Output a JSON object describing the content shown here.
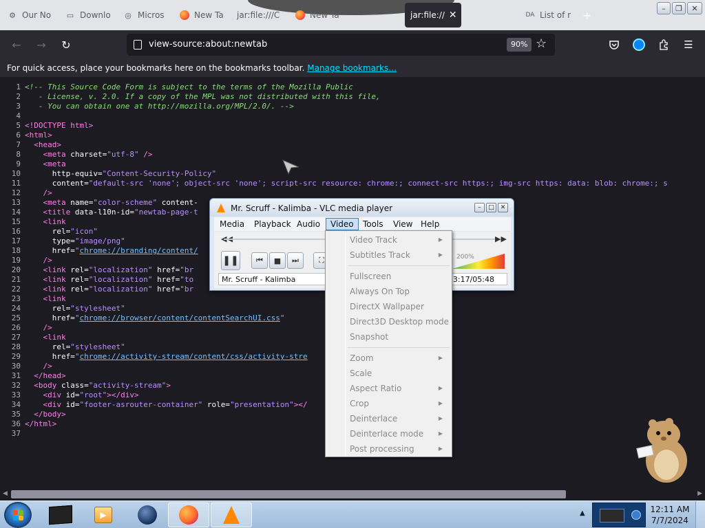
{
  "browser": {
    "tabs": [
      {
        "label": "Our No",
        "icon": "gear-icon"
      },
      {
        "label": "Downlo",
        "icon": "page-icon"
      },
      {
        "label": "Micros",
        "icon": "edge-icon"
      },
      {
        "label": "New Ta",
        "icon": "firefox-icon"
      },
      {
        "label": "jar:file:///C",
        "icon": ""
      },
      {
        "label": "New Ta",
        "icon": "firefox-icon"
      },
      {
        "label": "jar:file://",
        "icon": "",
        "active": true
      },
      {
        "label": "List of r",
        "icon": "DA"
      }
    ],
    "new_tab_symbol": "+",
    "window_controls": [
      "–",
      "❐",
      "✕"
    ],
    "url": "view-source:about:newtab",
    "zoom": "90%",
    "bookmarks_text": "For quick access, place your bookmarks here on the bookmarks toolbar.",
    "bookmarks_link": "Manage bookmarks…"
  },
  "source_lines": [
    [
      [
        "cm",
        "<!-- This Source Code Form is subject to the terms of the Mozilla Public"
      ]
    ],
    [
      [
        "cm",
        "   - License, v. 2.0. If a copy of the MPL was not distributed with this file,"
      ]
    ],
    [
      [
        "cm",
        "   - You can obtain one at http://mozilla.org/MPL/2.0/. -->"
      ]
    ],
    [],
    [
      [
        "tg",
        "<!DOCTYPE html>"
      ]
    ],
    [
      [
        "tg",
        "<html>"
      ]
    ],
    [
      [
        "t",
        "  "
      ],
      [
        "tg",
        "<head>"
      ]
    ],
    [
      [
        "t",
        "    "
      ],
      [
        "tg",
        "<meta "
      ],
      [
        "at",
        "charset="
      ],
      [
        "av",
        "\"utf-8\""
      ],
      [
        "tg",
        " />"
      ]
    ],
    [
      [
        "t",
        "    "
      ],
      [
        "tg",
        "<meta"
      ]
    ],
    [
      [
        "t",
        "      "
      ],
      [
        "at",
        "http-equiv="
      ],
      [
        "av",
        "\"Content-Security-Policy\""
      ]
    ],
    [
      [
        "t",
        "      "
      ],
      [
        "at",
        "content="
      ],
      [
        "av",
        "\"default-src 'none'; object-src 'none'; script-src resource: chrome:; connect-src https:; img-src https: data: blob: chrome:; s"
      ]
    ],
    [
      [
        "t",
        "    "
      ],
      [
        "tg",
        "/>"
      ]
    ],
    [
      [
        "t",
        "    "
      ],
      [
        "tg",
        "<meta "
      ],
      [
        "at",
        "name="
      ],
      [
        "av",
        "\"color-scheme\""
      ],
      [
        "at",
        " content-"
      ]
    ],
    [
      [
        "t",
        "    "
      ],
      [
        "tg",
        "<title "
      ],
      [
        "at",
        "data-l10n-id="
      ],
      [
        "av",
        "\"newtab-page-t"
      ]
    ],
    [
      [
        "t",
        "    "
      ],
      [
        "tg",
        "<link"
      ]
    ],
    [
      [
        "t",
        "      "
      ],
      [
        "at",
        "rel="
      ],
      [
        "av",
        "\"icon\""
      ]
    ],
    [
      [
        "t",
        "      "
      ],
      [
        "at",
        "type="
      ],
      [
        "av",
        "\"image/png\""
      ]
    ],
    [
      [
        "t",
        "      "
      ],
      [
        "at",
        "href="
      ],
      [
        "av",
        "\""
      ],
      [
        "lk",
        "chrome://branding/content/"
      ]
    ],
    [
      [
        "t",
        "    "
      ],
      [
        "tg",
        "/>"
      ]
    ],
    [
      [
        "t",
        "    "
      ],
      [
        "tg",
        "<link "
      ],
      [
        "at",
        "rel="
      ],
      [
        "av",
        "\"localization\""
      ],
      [
        "at",
        " href="
      ],
      [
        "av",
        "\"br"
      ]
    ],
    [
      [
        "t",
        "    "
      ],
      [
        "tg",
        "<link "
      ],
      [
        "at",
        "rel="
      ],
      [
        "av",
        "\"localization\""
      ],
      [
        "at",
        " href="
      ],
      [
        "av",
        "\"to"
      ]
    ],
    [
      [
        "t",
        "    "
      ],
      [
        "tg",
        "<link "
      ],
      [
        "at",
        "rel="
      ],
      [
        "av",
        "\"localization\""
      ],
      [
        "at",
        " href="
      ],
      [
        "av",
        "\"br"
      ]
    ],
    [
      [
        "t",
        "    "
      ],
      [
        "tg",
        "<link"
      ]
    ],
    [
      [
        "t",
        "      "
      ],
      [
        "at",
        "rel="
      ],
      [
        "av",
        "\"stylesheet\""
      ]
    ],
    [
      [
        "t",
        "      "
      ],
      [
        "at",
        "href="
      ],
      [
        "av",
        "\""
      ],
      [
        "lk",
        "chrome://browser/content/contentSearchUI.css"
      ],
      [
        "av",
        "\""
      ]
    ],
    [
      [
        "t",
        "    "
      ],
      [
        "tg",
        "/>"
      ]
    ],
    [
      [
        "t",
        "    "
      ],
      [
        "tg",
        "<link"
      ]
    ],
    [
      [
        "t",
        "      "
      ],
      [
        "at",
        "rel="
      ],
      [
        "av",
        "\"stylesheet\""
      ]
    ],
    [
      [
        "t",
        "      "
      ],
      [
        "at",
        "href="
      ],
      [
        "av",
        "\""
      ],
      [
        "lk",
        "chrome://activity-stream/content/css/activity-stre"
      ]
    ],
    [
      [
        "t",
        "    "
      ],
      [
        "tg",
        "/>"
      ]
    ],
    [
      [
        "t",
        "  "
      ],
      [
        "tg",
        "</head>"
      ]
    ],
    [
      [
        "t",
        "  "
      ],
      [
        "tg",
        "<body "
      ],
      [
        "at",
        "class="
      ],
      [
        "av",
        "\"activity-stream\""
      ],
      [
        "tg",
        ">"
      ]
    ],
    [
      [
        "t",
        "    "
      ],
      [
        "tg",
        "<div "
      ],
      [
        "at",
        "id="
      ],
      [
        "av",
        "\"root\""
      ],
      [
        "tg",
        "></div>"
      ]
    ],
    [
      [
        "t",
        "    "
      ],
      [
        "tg",
        "<div "
      ],
      [
        "at",
        "id="
      ],
      [
        "av",
        "\"footer-asrouter-container\""
      ],
      [
        "at",
        " role="
      ],
      [
        "av",
        "\"presentation\""
      ],
      [
        "tg",
        "></"
      ]
    ],
    [
      [
        "t",
        "  "
      ],
      [
        "tg",
        "</body>"
      ]
    ],
    [
      [
        "tg",
        "</html>"
      ]
    ],
    []
  ],
  "vlc": {
    "title": "Mr. Scruff - Kalimba - VLC media player",
    "menus": [
      "Media",
      "Playback",
      "Audio",
      "Video",
      "Tools",
      "View",
      "Help"
    ],
    "open_menu": "Video",
    "status_name": "Mr. Scruff - Kalimba",
    "status_time": "3:17/05:48",
    "volume_text": "200%",
    "video_menu": [
      {
        "label": "Video Track",
        "submenu": true
      },
      {
        "label": "Subtitles Track",
        "submenu": true
      },
      {
        "sep": true
      },
      {
        "label": "Fullscreen"
      },
      {
        "label": "Always On Top"
      },
      {
        "label": "DirectX Wallpaper"
      },
      {
        "label": "Direct3D Desktop mode"
      },
      {
        "label": "Snapshot"
      },
      {
        "sep": true
      },
      {
        "label": "Zoom",
        "submenu": true
      },
      {
        "label": "Scale"
      },
      {
        "label": "Aspect Ratio",
        "submenu": true
      },
      {
        "label": "Crop",
        "submenu": true
      },
      {
        "label": "Deinterlace",
        "submenu": true
      },
      {
        "label": "Deinterlace mode",
        "submenu": true
      },
      {
        "label": "Post processing",
        "submenu": true
      }
    ]
  },
  "taskbar": {
    "apps": [
      "terminal-app",
      "media-player-app",
      "globe-app",
      "firefox-app",
      "vlc-app"
    ],
    "time": "12:11 AM",
    "date": "7/7/2024"
  },
  "colors": {
    "accent": "#00ddff",
    "tag": "#ff7de9",
    "attr_value": "#b98eff",
    "comment": "#86de74",
    "vlc_orange": "#ff8800"
  }
}
